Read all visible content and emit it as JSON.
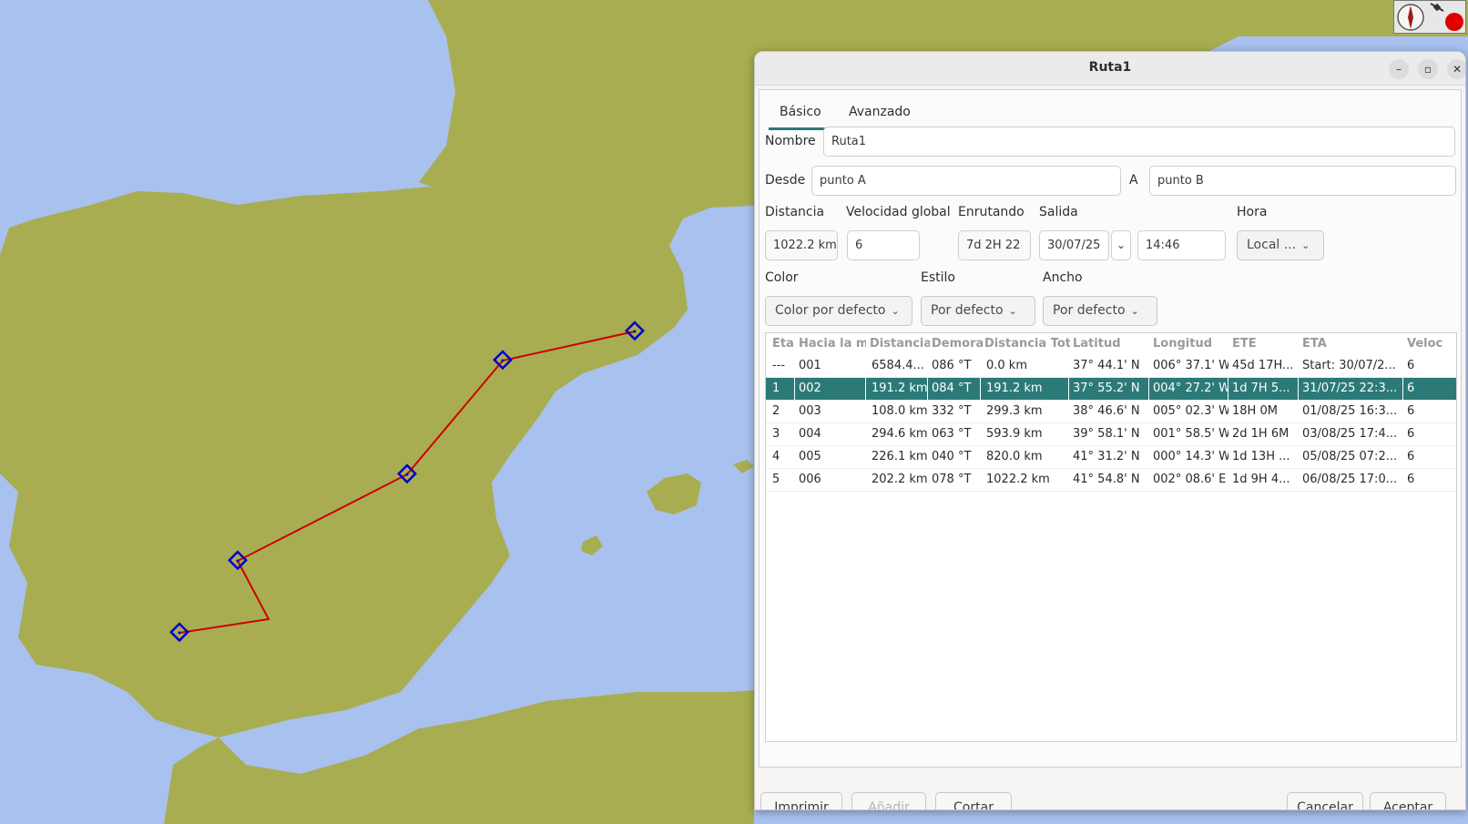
{
  "dialog": {
    "title": "Ruta1",
    "tabs": [
      {
        "label": "Básico",
        "active": true
      },
      {
        "label": "Avanzado",
        "active": false
      }
    ],
    "name_label": "Nombre",
    "name_value": "Ruta1",
    "from_label": "Desde",
    "from_value": "punto A",
    "to_label": "A",
    "to_value": "punto B",
    "distance_label": "Distancia",
    "distance_value": "1022.2 km",
    "speed_label": "Velocidad global",
    "speed_value": "6",
    "routing_label": "Enrutando",
    "routing_value": "7d  2H 22",
    "departure_label": "Salida",
    "departure_date": "30/07/25",
    "departure_time": "14:46",
    "hour_label": "Hora",
    "hour_value": "Local ...",
    "color_label": "Color",
    "color_value": "Color por defecto",
    "style_label": "Estilo",
    "style_value": "Por defecto",
    "width_label": "Ancho",
    "width_value": "Por defecto",
    "table": {
      "headers": [
        "Eta",
        "Hacia la ma",
        "Distancia",
        "Demora",
        "Distancia Tota",
        "Latitud",
        "Longitud",
        "ETE",
        "ETA",
        "Veloc"
      ],
      "rows": [
        [
          "---",
          "001",
          "6584.4...",
          "086 °T",
          "0.0 km",
          "37° 44.1' N",
          "006° 37.1' W",
          "45d 17H...",
          "Start: 30/07/2...",
          "6"
        ],
        [
          "1",
          "002",
          "191.2 km",
          "084 °T",
          "191.2 km",
          "37° 55.2' N",
          "004° 27.2' W",
          "1d  7H 5...",
          "31/07/25 22:3...",
          "6"
        ],
        [
          "2",
          "003",
          "108.0 km",
          "332 °T",
          "299.3 km",
          "38° 46.6' N",
          "005° 02.3' W",
          "18H  0M",
          "01/08/25 16:3...",
          "6"
        ],
        [
          "3",
          "004",
          "294.6 km",
          "063 °T",
          "593.9 km",
          "39° 58.1' N",
          "001° 58.5' W",
          "2d  1H  6M",
          "03/08/25 17:4...",
          "6"
        ],
        [
          "4",
          "005",
          "226.1 km",
          "040 °T",
          "820.0 km",
          "41° 31.2' N",
          "000° 14.3' W",
          "1d 13H ...",
          "05/08/25 07:2...",
          "6"
        ],
        [
          "5",
          "006",
          "202.2 km",
          "078 °T",
          "1022.2 km",
          "41° 54.8' N",
          "002° 08.6' E",
          "1d  9H 4...",
          "06/08/25 17:0...",
          "6"
        ]
      ],
      "selected_row": 1
    },
    "buttons": {
      "print": "Imprimir",
      "add": "Añadir",
      "cut": "Cortar",
      "cancel": "Cancelar",
      "accept": "Aceptar"
    }
  },
  "map": {
    "land_color": "#a8ad52",
    "sea_color": "#a9c1ee",
    "route_color": "#cc0000",
    "waypoint_color": "#0000cc"
  },
  "icons": {
    "window": [
      "minimize-icon",
      "maximize-icon",
      "close-icon"
    ],
    "status": [
      "compass-icon",
      "satellite-status-icon"
    ]
  }
}
